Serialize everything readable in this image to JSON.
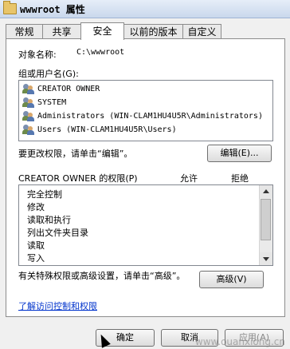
{
  "window": {
    "title": "wwwroot 属性"
  },
  "tabs": [
    {
      "label": "常规"
    },
    {
      "label": "共享"
    },
    {
      "label": "安全"
    },
    {
      "label": "以前的版本"
    },
    {
      "label": "自定义"
    }
  ],
  "security": {
    "object_name_label": "对象名称:",
    "object_name_value": "C:\\wwwroot",
    "groups_label": "组或用户名(G):",
    "users": [
      {
        "name": "CREATOR OWNER"
      },
      {
        "name": "SYSTEM"
      },
      {
        "name": "Administrators (WIN-CLAM1HU4U5R\\Administrators)"
      },
      {
        "name": "Users (WIN-CLAM1HU4U5R\\Users)"
      }
    ],
    "edit_hint": "要更改权限，请单击“编辑”。",
    "edit_button": "编辑(E)...",
    "permissions_label": "CREATOR OWNER 的权限(P)",
    "allow_header": "允许",
    "deny_header": "拒绝",
    "permissions": [
      {
        "name": "完全控制"
      },
      {
        "name": "修改"
      },
      {
        "name": "读取和执行"
      },
      {
        "name": "列出文件夹目录"
      },
      {
        "name": "读取"
      },
      {
        "name": "写入"
      }
    ],
    "advanced_hint": "有关特殊权限或高级设置，请单击“高级”。",
    "advanced_button": "高级(V)",
    "learn_link": "了解访问控制和权限"
  },
  "footer": {
    "ok_button": "确定",
    "cancel_button": "取消",
    "apply_button": "应用(A)"
  },
  "watermark": "www.ouanxiong.cn"
}
